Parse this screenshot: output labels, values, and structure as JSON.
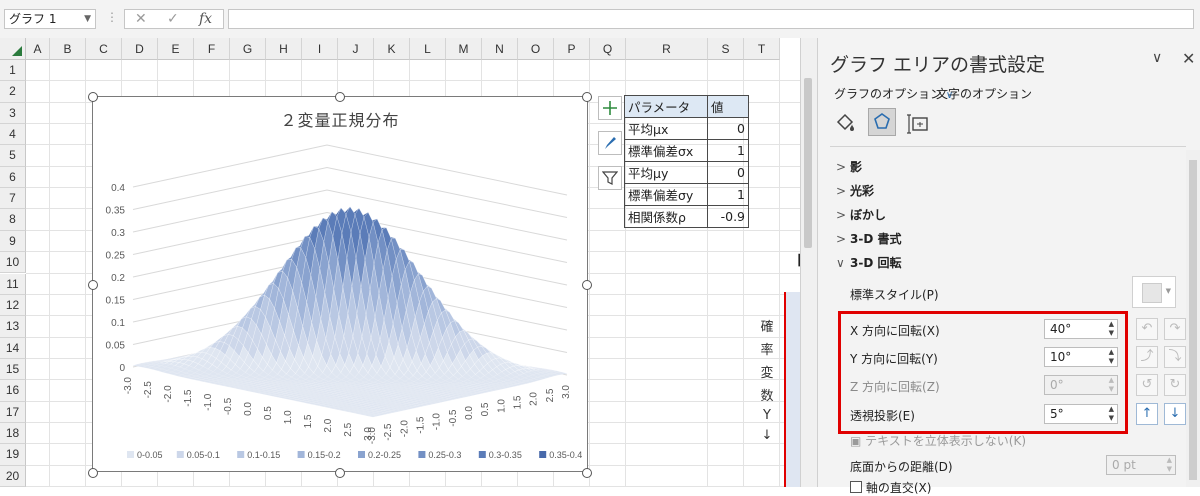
{
  "formula_bar": {
    "name_box": "グラフ 1",
    "cancel_icon": "✕",
    "enter_icon": "✓",
    "fx_label": "fx",
    "formula": ""
  },
  "columns": [
    "A",
    "B",
    "C",
    "D",
    "E",
    "F",
    "G",
    "H",
    "I",
    "J",
    "K",
    "L",
    "M",
    "N",
    "O",
    "P",
    "Q",
    "R",
    "S",
    "T"
  ],
  "rows": [
    "1",
    "2",
    "3",
    "4",
    "5",
    "6",
    "7",
    "8",
    "9",
    "10",
    "11",
    "12",
    "13",
    "14",
    "15",
    "16",
    "17",
    "18",
    "19",
    "20"
  ],
  "param_table": {
    "header": [
      "パラメータ",
      "値"
    ],
    "rows": [
      [
        "平均μx",
        "0"
      ],
      [
        "標準偏差σx",
        "1"
      ],
      [
        "平均μy",
        "0"
      ],
      [
        "標準偏差σy",
        "1"
      ],
      [
        "相関係数ρ",
        "-0.9"
      ]
    ]
  },
  "vertical_label": [
    "確",
    "率",
    "変",
    "数",
    "Y",
    "↓"
  ],
  "side_label": "【",
  "chart_controls": [
    "chart-elements-plus",
    "chart-styles-brush",
    "chart-filter-funnel"
  ],
  "chart_data": {
    "type": "surface3d",
    "title": "２変量正規分布",
    "z_ticks": [
      "0.4",
      "0.35",
      "0.3",
      "0.25",
      "0.2",
      "0.15",
      "0.1",
      "0.05",
      "0"
    ],
    "x_ticks": [
      "-3.0",
      "-2.5",
      "-2.0",
      "-1.5",
      "-1.0",
      "-0.5",
      "0.0",
      "0.5",
      "1.0",
      "1.5",
      "2.0",
      "2.5",
      "3.0"
    ],
    "y_ticks": [
      "-3.0",
      "-2.5",
      "-2.0",
      "-1.5",
      "-1.0",
      "-0.5",
      "0.0",
      "0.5",
      "1.0",
      "1.5",
      "2.0",
      "2.5",
      "3.0"
    ],
    "zlim": [
      0,
      0.4
    ],
    "peak": {
      "x": 0,
      "y": 0,
      "z": 0.365
    },
    "correlation": -0.9,
    "legend": [
      {
        "label": "0-0.05",
        "color": "#dfe6f1"
      },
      {
        "label": "0.05-0.1",
        "color": "#cdd7ea"
      },
      {
        "label": "0.1-0.15",
        "color": "#b9c8e3"
      },
      {
        "label": "0.15-0.2",
        "color": "#a2b6da"
      },
      {
        "label": "0.2-0.25",
        "color": "#8aa3cf"
      },
      {
        "label": "0.25-0.3",
        "color": "#7390c4"
      },
      {
        "label": "0.3-0.35",
        "color": "#5b7cb8"
      },
      {
        "label": "0.35-0.4",
        "color": "#4869aa"
      }
    ],
    "legend_position": "bottom",
    "grid": true
  },
  "pane": {
    "title": "グラフ エリアの書式設定",
    "options_tab": "グラフのオプション",
    "text_options_tab": "文字のオプション",
    "sections": [
      "影",
      "光彩",
      "ぼかし",
      "3-D 書式",
      "3-D 回転"
    ],
    "preset_label": "標準スタイル(P)",
    "fields": [
      {
        "label": "X 方向に回転(X)",
        "value": "40°"
      },
      {
        "label": "Y 方向に回転(Y)",
        "value": "10°"
      },
      {
        "label": "Z 方向に回転(Z)",
        "value": "0°"
      },
      {
        "label": "透視投影(E)",
        "value": "5°"
      }
    ],
    "keep_text_flat": "テキストを立体表示しない(K)",
    "distance_label": "底面からの距離(D)",
    "distance_value": "0 pt",
    "axis_label": "軸の直交(X)"
  },
  "colors": {
    "accent": "#2a6db0",
    "highlight": "#e00000",
    "excel_green": "#2a7a3c"
  }
}
